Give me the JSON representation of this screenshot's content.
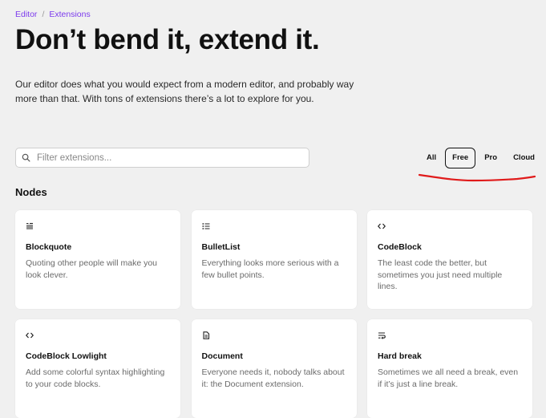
{
  "breadcrumb": {
    "root": "Editor",
    "separator": "/",
    "current": "Extensions"
  },
  "page_title": "Don’t bend it, extend it.",
  "intro": "Our editor does what you would expect from a modern editor, and probably way more than that. With tons of extensions there’s a lot to explore for you.",
  "search": {
    "placeholder": "Filter extensions...",
    "value": ""
  },
  "filters": [
    {
      "label": "All",
      "active": false
    },
    {
      "label": "Free",
      "active": true
    },
    {
      "label": "Pro",
      "active": false
    },
    {
      "label": "Cloud",
      "active": false
    }
  ],
  "annotation_color": "#e01b1b",
  "accent_color": "#7c3aed",
  "section_title": "Nodes",
  "cards": [
    {
      "icon": "blockquote-icon",
      "name": "Blockquote",
      "desc": "Quoting other people will make you look clever."
    },
    {
      "icon": "bullet-list-icon",
      "name": "BulletList",
      "desc": "Everything looks more serious with a few bullet points."
    },
    {
      "icon": "code-icon",
      "name": "CodeBlock",
      "desc": "The least code the better, but sometimes you just need multiple lines."
    },
    {
      "icon": "code-icon",
      "name": "CodeBlock Lowlight",
      "desc": "Add some colorful syntax highlighting to your code blocks."
    },
    {
      "icon": "document-icon",
      "name": "Document",
      "desc": "Everyone needs it, nobody talks about it: the Document extension."
    },
    {
      "icon": "hard-break-icon",
      "name": "Hard break",
      "desc": "Sometimes we all need a break, even if it’s just a line break."
    }
  ]
}
